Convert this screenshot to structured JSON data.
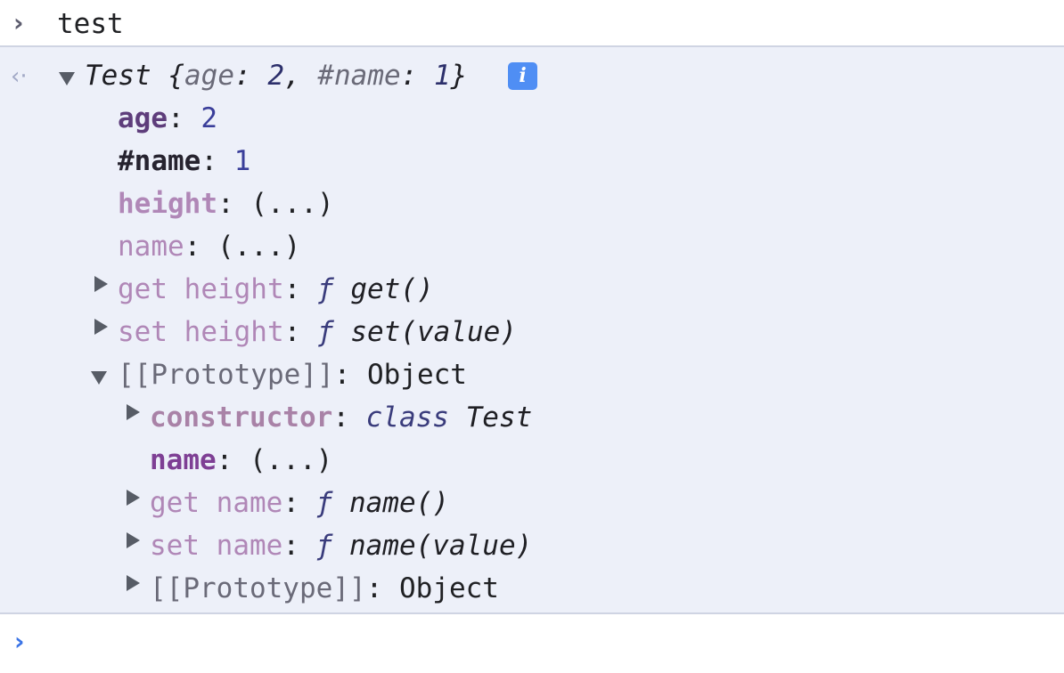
{
  "input": {
    "prompt_icon": "chevron-right-icon",
    "prompt_glyph": "›",
    "command": "test"
  },
  "result": {
    "result_icon": "return-arrow-icon",
    "result_glyph": "‹·",
    "summary": {
      "class_name": "Test",
      "open_brace": "{",
      "prop1_key": "age",
      "prop1_sep": ": ",
      "prop1_value": "2",
      "comma": ", ",
      "prop2_key": "#name",
      "prop2_sep": ": ",
      "prop2_value": "1",
      "close_brace": "}"
    },
    "info_badge": "i",
    "properties": {
      "age_key": "age",
      "age_value": "2",
      "private_name_key": "#name",
      "private_name_value": "1",
      "height_key": "height",
      "height_value": "(...)",
      "name_key": "name",
      "name_value": "(...)",
      "get_height_key": "get height",
      "get_height_f": "ƒ",
      "get_height_sig": "get()",
      "set_height_key": "set height",
      "set_height_f": "ƒ",
      "set_height_sig": "set(value)",
      "prototype_key": "[[Prototype]]",
      "prototype_value": "Object"
    },
    "prototype": {
      "constructor_key": "constructor",
      "constructor_kw": "class",
      "constructor_name": "Test",
      "name_key": "name",
      "name_value": "(...)",
      "get_name_key": "get name",
      "get_name_f": "ƒ",
      "get_name_sig": "name()",
      "set_name_key": "set name",
      "set_name_f": "ƒ",
      "set_name_sig": "name(value)",
      "inner_prototype_key": "[[Prototype]]",
      "inner_prototype_value": "Object"
    },
    "colon": ": "
  },
  "bottom": {
    "prompt_icon": "chevron-right-icon",
    "prompt_glyph": "›"
  },
  "colors": {
    "output_background": "#edf0f9",
    "info_badge": "#4f8ef4",
    "active_prompt": "#3b74e6"
  }
}
